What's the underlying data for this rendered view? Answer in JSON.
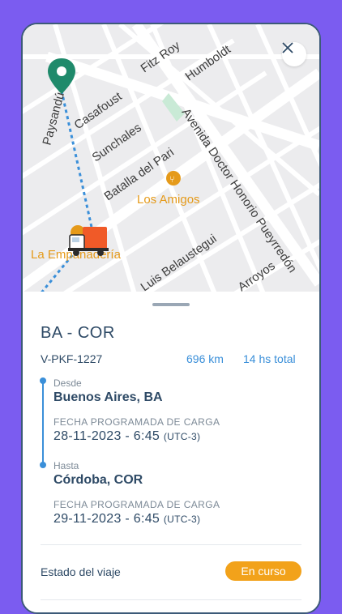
{
  "map": {
    "streets": [
      "Fitz Roy",
      "Humboldt",
      "Paysandú",
      "Casafoust",
      "Sunchales",
      "Batalla del Pari",
      "Avenida Doctor Honorio Pueyrredón",
      "Luis Belaustegui",
      "Arroyos"
    ],
    "places": [
      "Los Amigos",
      "La Empanadería"
    ],
    "colors": {
      "place": "#e59a1a",
      "route": "#3a8fd9",
      "pin": "#1f8a6b",
      "truck": "#f05a28"
    }
  },
  "sheet": {
    "route": "BA - COR",
    "plate": "V-PKF-1227",
    "distance": "696 km",
    "duration": "14 hs total",
    "origin_label": "Desde",
    "origin_city": "Buenos Aires, BA",
    "origin_sched_label": "FECHA PROGRAMADA DE CARGA",
    "origin_date": "28-11-2023 - 6:45",
    "origin_tz": "(UTC-3)",
    "dest_label": "Hasta",
    "dest_city": "Córdoba, COR",
    "dest_sched_label": "FECHA PROGRAMADA DE CARGA",
    "dest_date": "29-11-2023 - 6:45",
    "dest_tz": "(UTC-3)",
    "status_label": "Estado del viaje",
    "status_value": "En curso",
    "status_color": "#f2a21a"
  }
}
